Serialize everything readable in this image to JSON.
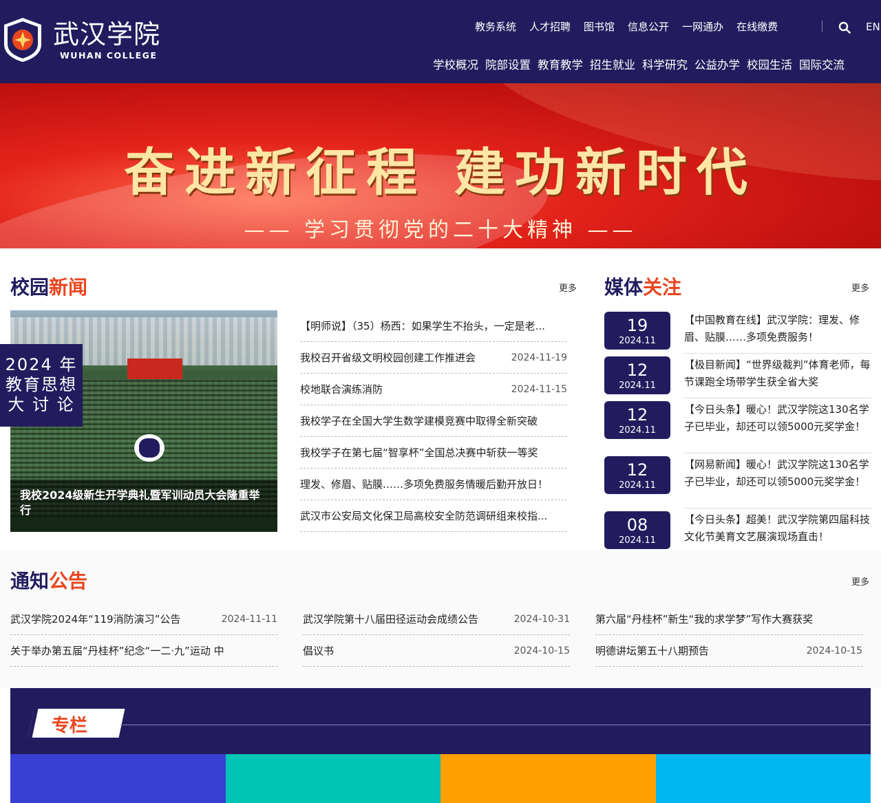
{
  "header": {
    "logo_cn": "武汉学院",
    "logo_en": "WUHAN COLLEGE",
    "top_links": [
      "教务系统",
      "人才招聘",
      "图书馆",
      "信息公开",
      "一网通办",
      "在线缴费"
    ],
    "lang": "EN",
    "search_icon": "search-icon",
    "nav": [
      "学校概况",
      "院部设置",
      "教育教学",
      "招生就业",
      "科学研究",
      "公益办学",
      "校园生活",
      "国际交流"
    ]
  },
  "banner": {
    "title": "奋进新征程 建功新时代",
    "subtitle": "—— 学习贯彻党的二十大精神 ——"
  },
  "campus_news": {
    "title_a": "校园",
    "title_b": "新闻",
    "more": "更多",
    "badge": "2024 年 教育思想 大 讨 论",
    "photo_caption": "我校2024级新生开学典礼暨军训动员大会隆重举行",
    "items": [
      {
        "title": "【明师说】（35）杨西：如果学生不抬头，一定是老...",
        "date": ""
      },
      {
        "title": "我校召开省级文明校园创建工作推进会",
        "date": "2024-11-19"
      },
      {
        "title": "校地联合演练消防",
        "date": "2024-11-15"
      },
      {
        "title": "我校学子在全国大学生数学建模竞赛中取得全新突破",
        "date": ""
      },
      {
        "title": "我校学子在第七届“智享杯”全国总决赛中斩获一等奖",
        "date": ""
      },
      {
        "title": "理发、修眉、贴膜……多项免费服务情暖后勤开放日！",
        "date": ""
      },
      {
        "title": "武汉市公安局文化保卫局高校安全防范调研组来校指...",
        "date": ""
      }
    ]
  },
  "media": {
    "title_a": "媒体",
    "title_b": "关注",
    "more": "更多",
    "items": [
      {
        "day": "19",
        "ym": "2024.11",
        "text": "【中国教育在线】武汉学院：理发、修眉、贴膜……多项免费服务！"
      },
      {
        "day": "12",
        "ym": "2024.11",
        "text": "【极目新闻】“世界级裁判”体育老师，每节课跑全场带学生获全省大奖"
      },
      {
        "day": "12",
        "ym": "2024.11",
        "text": "【今日头条】暖心！武汉学院这130名学子已毕业，却还可以领5000元奖学金！"
      },
      {
        "day": "12",
        "ym": "2024.11",
        "text": "【网易新闻】暖心！武汉学院这130名学子已毕业，却还可以领5000元奖学金！"
      },
      {
        "day": "08",
        "ym": "2024.11",
        "text": "【今日头条】超美！武汉学院第四届科技文化节美育文艺展演现场直击！"
      }
    ]
  },
  "notices": {
    "title_a": "通知",
    "title_b": "公告",
    "more": "更多",
    "columns": [
      [
        {
          "title": "武汉学院2024年“119消防演习”公告",
          "date": "2024-11-11"
        },
        {
          "title": "关于举办第五届“丹桂杯”纪念“一二·九”运动 中",
          "date": ""
        }
      ],
      [
        {
          "title": "武汉学院第十八届田径运动会成绩公告",
          "date": "2024-10-31"
        },
        {
          "title": "倡议书",
          "date": "2024-10-15"
        }
      ],
      [
        {
          "title": "第六届“丹桂杯”新生“我的求学梦”写作大赛获奖",
          "date": ""
        },
        {
          "title": "明德讲坛第五十八期预告",
          "date": "2024-10-15"
        }
      ]
    ]
  },
  "special": {
    "label": "专栏",
    "tile_colors": [
      "#3a3fd4",
      "#00c4b4",
      "#ff9f00",
      "#00b6ef"
    ]
  }
}
